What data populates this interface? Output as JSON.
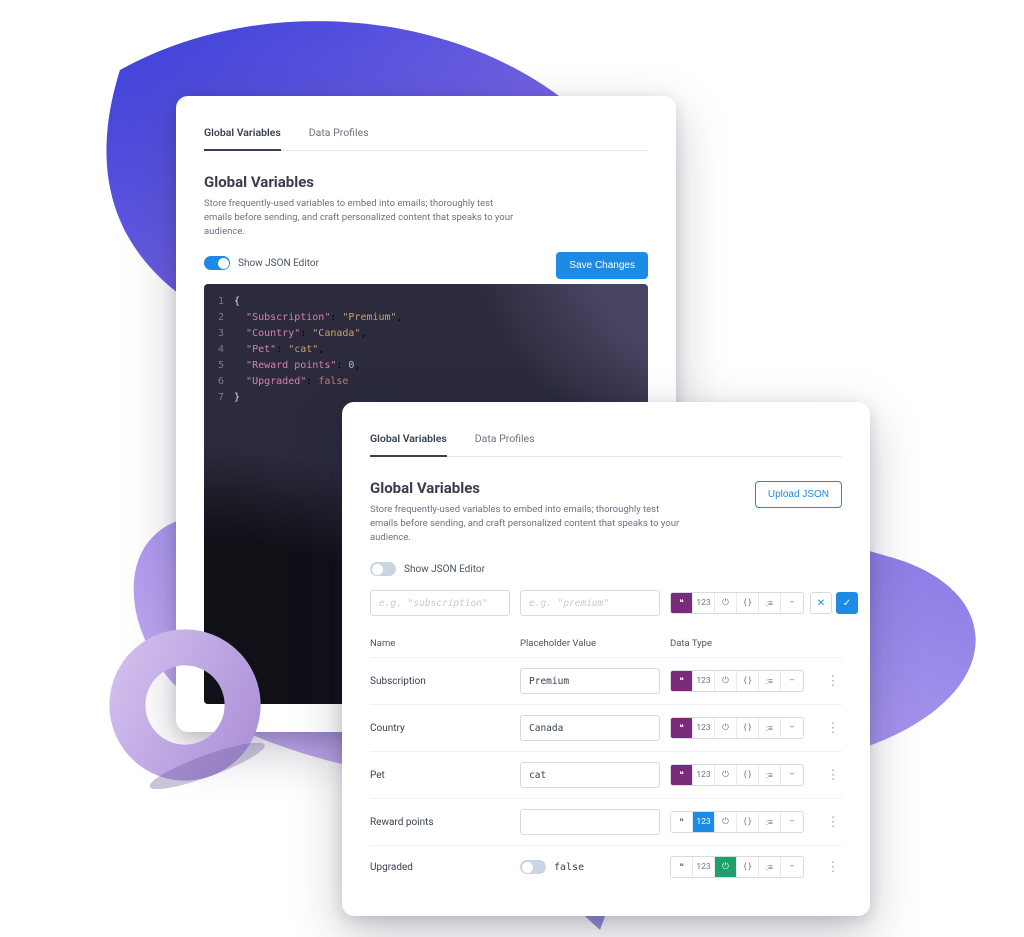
{
  "tabs": {
    "global_variables": "Global Variables",
    "data_profiles": "Data Profiles"
  },
  "section": {
    "title": "Global Variables",
    "description": "Store frequently-used variables to embed into emails; thoroughly test emails before sending, and craft personalized content that speaks to your audience."
  },
  "back_card": {
    "toggle_label": "Show JSON Editor",
    "toggle_on": true,
    "save_button": "Save Changes",
    "json_lines": [
      {
        "n": 1,
        "html": "<span class='tok-brace'>{</span>"
      },
      {
        "n": 2,
        "html": "&nbsp;&nbsp;<span class='tok-key'>\"Subscription\"</span>: <span class='tok-str'>\"Premium\"</span>,"
      },
      {
        "n": 3,
        "html": "&nbsp;&nbsp;<span class='tok-key'>\"Country\"</span>: <span class='tok-str'>\"Canada\"</span>,"
      },
      {
        "n": 4,
        "html": "&nbsp;&nbsp;<span class='tok-key'>\"Pet\"</span>: <span class='tok-str'>\"cat\"</span>,"
      },
      {
        "n": 5,
        "html": "&nbsp;&nbsp;<span class='tok-key'>\"Reward points\"</span>: <span class='tok-num'>0</span>,"
      },
      {
        "n": 6,
        "html": "&nbsp;&nbsp;<span class='tok-key'>\"Upgraded\"</span>: <span class='tok-bool'>false</span>"
      },
      {
        "n": 7,
        "html": "<span class='tok-brace'>}</span>"
      }
    ],
    "json_object": {
      "Subscription": "Premium",
      "Country": "Canada",
      "Pet": "cat",
      "Reward points": 0,
      "Upgraded": false
    }
  },
  "front_card": {
    "upload_button": "Upload JSON",
    "toggle_label": "Show JSON Editor",
    "toggle_on": false,
    "new_row": {
      "name_placeholder": "e.g. \"subscription\"",
      "value_placeholder": "e.g. \"premium\"",
      "selected_type_index": 0
    },
    "type_chip_labels": [
      "string",
      "number",
      "boolean",
      "object",
      "array",
      "null"
    ],
    "columns": {
      "name": "Name",
      "value": "Placeholder Value",
      "type": "Data Type"
    },
    "rows": [
      {
        "name": "Subscription",
        "value": "Premium",
        "kind": "text",
        "selected_type_index": 0
      },
      {
        "name": "Country",
        "value": "Canada",
        "kind": "text",
        "selected_type_index": 0
      },
      {
        "name": "Pet",
        "value": "cat",
        "kind": "text",
        "selected_type_index": 0
      },
      {
        "name": "Reward points",
        "value": "",
        "kind": "text",
        "selected_type_index": 1
      },
      {
        "name": "Upgraded",
        "value": "false",
        "kind": "bool",
        "bool_on": false,
        "selected_type_index": 2
      }
    ]
  },
  "colors": {
    "accent_blue": "#1d8ae6",
    "accent_purple": "#7a2a7a",
    "accent_green": "#1fa06b"
  }
}
